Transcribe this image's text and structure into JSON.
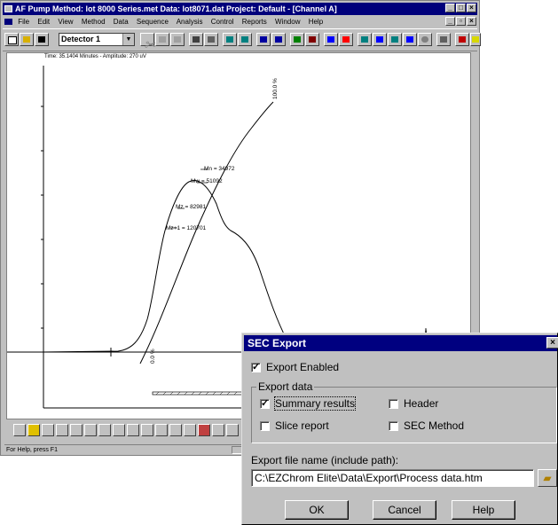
{
  "window": {
    "title": "AF Pump     Method: lot 8000 Series.met     Data: lot8071.dat     Project: Default - [Channel A]",
    "min_label": "_",
    "max_label": "□",
    "close_label": "×"
  },
  "menu": [
    "File",
    "Edit",
    "View",
    "Method",
    "Data",
    "Sequence",
    "Analysis",
    "Control",
    "Reports",
    "Window",
    "Help"
  ],
  "detector": {
    "selected": "Detector 1"
  },
  "plot": {
    "time_readout": "Time:  35.1404 Minutes - Amplitude:  270 uV",
    "labels": {
      "p100": "100.0 %",
      "p0": "0.0 %",
      "mn": "Mn = 34972",
      "mw": "Mw = 51092",
      "mz": "Mz = 82981",
      "mz1": "Mz+1 = 120701"
    }
  },
  "status": {
    "help": "For Help, press F1"
  },
  "dialog": {
    "title": "SEC Export",
    "close": "×",
    "export_enabled": {
      "label": "Export Enabled",
      "checked": true
    },
    "group_title": "Export data",
    "options": {
      "summary": {
        "label": "Summary results",
        "checked": true
      },
      "header": {
        "label": "Header",
        "checked": false
      },
      "slice": {
        "label": "Slice report",
        "checked": false
      },
      "sec_method": {
        "label": "SEC Method",
        "checked": false
      }
    },
    "file_label": "Export file name (include path):",
    "file_value": "C:\\EZChrom Elite\\Data\\Export\\Process data.htm",
    "buttons": {
      "ok": "OK",
      "cancel": "Cancel",
      "help": "Help"
    }
  },
  "colors": {
    "title_bar": "#00007b",
    "face": "#c0c0c0"
  }
}
